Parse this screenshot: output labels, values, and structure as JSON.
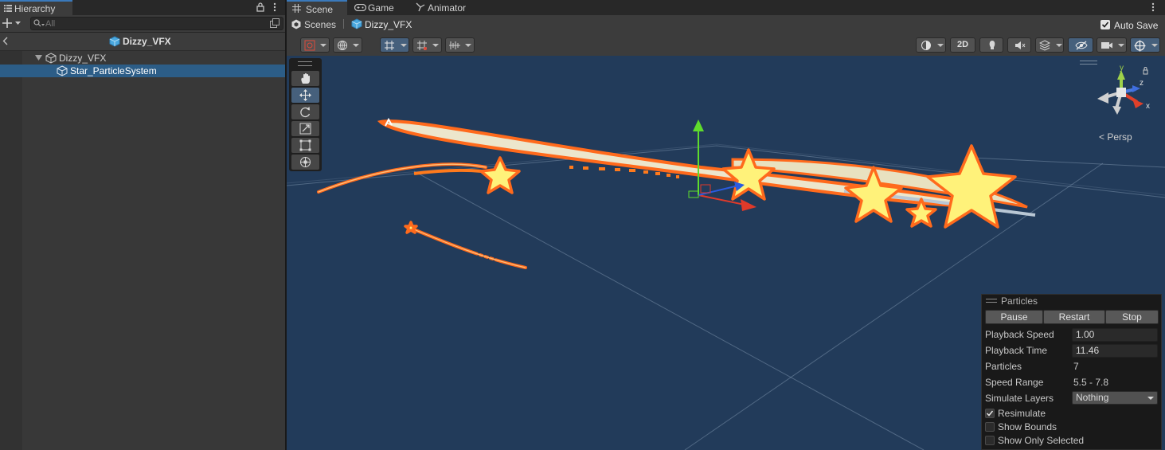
{
  "hierarchy": {
    "tab_label": "Hierarchy",
    "search_placeholder": "All",
    "scene_name": "Dizzy_VFX",
    "tree": [
      {
        "label": "Dizzy_VFX",
        "selected": false
      },
      {
        "label": "Star_ParticleSystem",
        "selected": true
      }
    ]
  },
  "scene_view": {
    "tabs": [
      {
        "label": "Scene",
        "icon": "grid-icon",
        "active": true
      },
      {
        "label": "Game",
        "icon": "gamepad-icon",
        "active": false
      },
      {
        "label": "Animator",
        "icon": "animator-icon",
        "active": false
      }
    ],
    "breadcrumb": {
      "root": "Scenes",
      "current": "Dizzy_VFX"
    },
    "auto_save": {
      "label": "Auto Save",
      "checked": true
    },
    "toolbar_2d_label": "2D",
    "persp_label": "< Persp",
    "gizmo_axes": {
      "y": "y",
      "z": "z",
      "x": "x"
    }
  },
  "particles": {
    "title": "Particles",
    "buttons": {
      "pause": "Pause",
      "restart": "Restart",
      "stop": "Stop"
    },
    "rows": {
      "playback_speed": {
        "label": "Playback Speed",
        "value": "1.00"
      },
      "playback_time": {
        "label": "Playback Time",
        "value": "11.46"
      },
      "particles": {
        "label": "Particles",
        "value": "7"
      },
      "speed_range": {
        "label": "Speed Range",
        "value": "5.5 - 7.8"
      },
      "simulate_layers": {
        "label": "Simulate Layers",
        "value": "Nothing"
      }
    },
    "checkboxes": {
      "resimulate": {
        "label": "Resimulate",
        "checked": true
      },
      "show_bounds": {
        "label": "Show Bounds",
        "checked": false
      },
      "show_only_selected": {
        "label": "Show Only Selected",
        "checked": false
      }
    }
  },
  "colors": {
    "accent": "#3a79bb",
    "selection": "#2c5d87",
    "viewport_bg": "#223b5a",
    "star_fill": "#fff27a",
    "star_outline": "#ff7a1c"
  }
}
